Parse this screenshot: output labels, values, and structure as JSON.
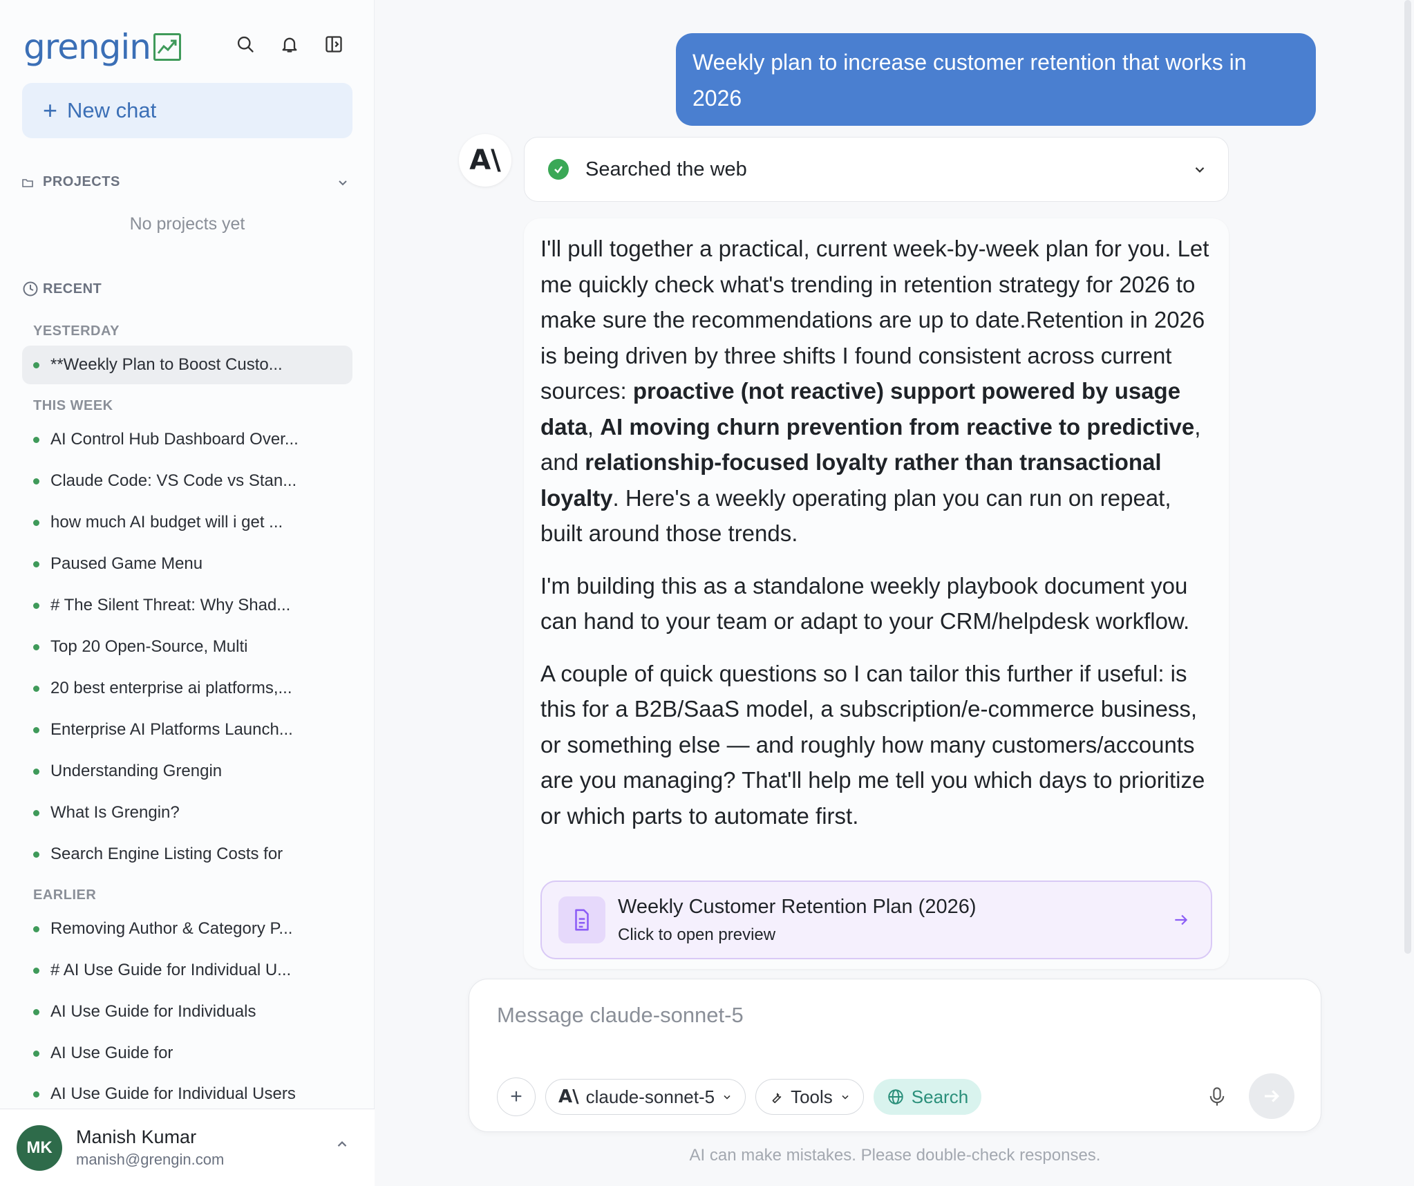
{
  "sidebar": {
    "logo_text": "grengin",
    "new_chat_label": "New chat",
    "projects_label": "PROJECTS",
    "no_projects_text": "No projects yet",
    "recent_label": "RECENT",
    "groups": {
      "yesterday": "YESTERDAY",
      "this_week": "THIS WEEK",
      "earlier": "EARLIER"
    },
    "yesterday_items": [
      "**Weekly Plan to Boost Custo..."
    ],
    "this_week_items": [
      "AI Control Hub Dashboard Over...",
      "Claude Code: VS Code vs Stan...",
      "how much AI budget will i get ...",
      "Paused Game Menu",
      "# The Silent Threat: Why Shad...",
      "Top 20 Open-Source, Multi",
      "20 best enterprise ai platforms,...",
      "Enterprise AI Platforms Launch...",
      "Understanding Grengin",
      "What Is Grengin?",
      "Search Engine Listing Costs for"
    ],
    "earlier_items": [
      "Removing Author & Category P...",
      "# AI Use Guide for Individual U...",
      "AI Use Guide for Individuals",
      "AI Use Guide for",
      "AI Use Guide for Individual Users"
    ],
    "user": {
      "initials": "MK",
      "name": "Manish Kumar",
      "email": "manish@grengin.com"
    }
  },
  "conversation": {
    "user_message": "Weekly plan to increase customer retention that works in 2026",
    "assistant_logo": "A\\",
    "tool_status": "Searched the web",
    "paragraph1": {
      "t1": "I'll pull together a practical, current week-by-week plan for you. Let me quickly check what's trending in retention strategy for 2026 to make sure the recommendations are up to date.Retention in 2026 is being driven by three shifts I found consistent across current sources: ",
      "b1": "proactive (not reactive) support powered by usage data",
      "t2": ", ",
      "b2": "AI moving churn prevention from reactive to predictive",
      "t3": ", and ",
      "b3": "relationship-focused loyalty rather than transactional loyalty",
      "t4": ". Here's a weekly operating plan you can run on repeat, built around those trends."
    },
    "paragraph2": "I'm building this as a standalone weekly playbook document you can hand to your team or adapt to your CRM/helpdesk workflow.",
    "paragraph3": "A couple of quick questions so I can tailor this further if useful: is this for a B2B/SaaS model, a subscription/e-commerce business, or something else — and roughly how many customers/accounts are you managing? That'll help me tell you which days to prioritize or which parts to automate first.",
    "document_card": {
      "title": "Weekly Customer Retention Plan (2026)",
      "subtitle": "Click to open preview"
    }
  },
  "composer": {
    "placeholder": "Message claude-sonnet-5",
    "model_label": "claude-sonnet-5",
    "tools_label": "Tools",
    "search_label": "Search"
  },
  "disclaimer": "AI can make mistakes. Please double-check responses.",
  "colors": {
    "brand": "#3b6fb6",
    "user_bubble": "#4a7fd0",
    "status_dot": "#3f9a5a",
    "search_active": "#2a8f7a"
  }
}
